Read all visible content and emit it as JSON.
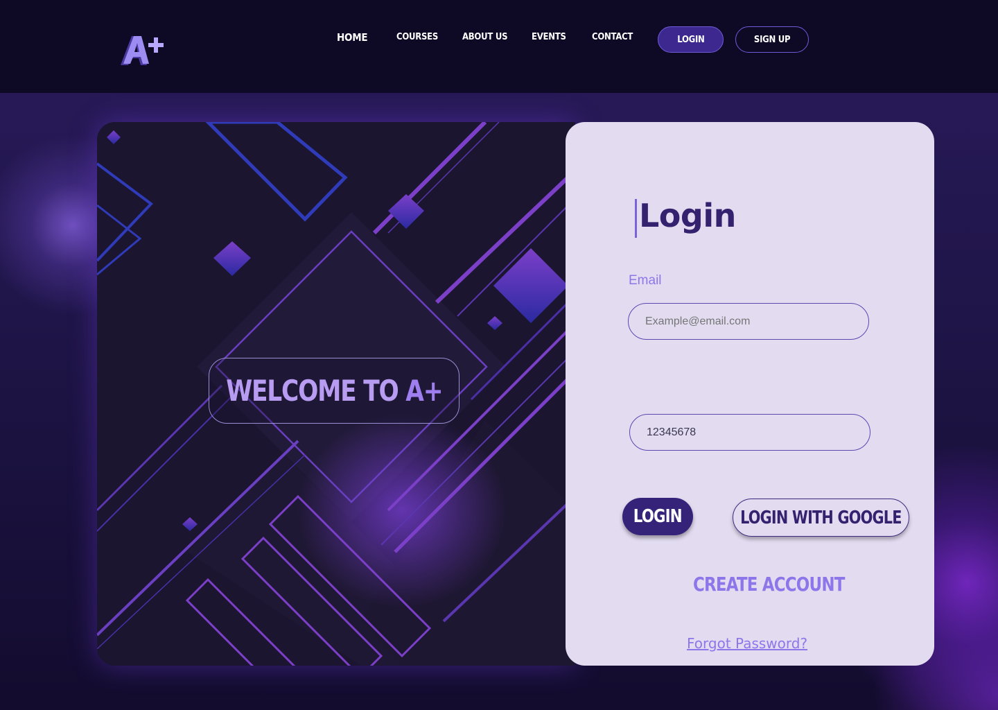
{
  "nav": {
    "logo_text": "A+",
    "links": [
      "HOME",
      "COURSES",
      "ABOUT US",
      "EVENTS",
      "CONTACT"
    ],
    "login_label": "LOGIN",
    "signup_label": "SIGN UP"
  },
  "hero": {
    "welcome_prefix": "WELCOME TO",
    "welcome_brand": "A+"
  },
  "login": {
    "title": "Login",
    "email_label": "Email",
    "email_placeholder": "Example@email.com",
    "password_value": "12345678",
    "login_button": "LOGIN",
    "google_button": "LOGIN WITH GOOGLE",
    "create_account": "CREATE ACCOUNT",
    "forgot_password": "Forgot Password?"
  },
  "colors": {
    "navbar": "#0e0a26",
    "accent": "#8d75ea",
    "primary": "#35226f",
    "card": "#e3dcf1"
  }
}
